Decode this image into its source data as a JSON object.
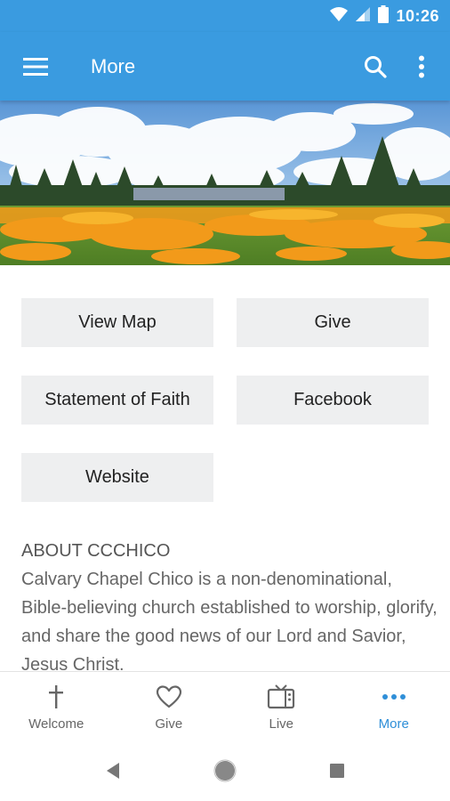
{
  "status": {
    "time": "10:26"
  },
  "app_bar": {
    "title": "More"
  },
  "buttons": [
    {
      "label": "View Map"
    },
    {
      "label": "Give"
    },
    {
      "label": "Statement of Faith"
    },
    {
      "label": "Facebook"
    },
    {
      "label": "Website"
    }
  ],
  "about": {
    "heading": "ABOUT CCCHICO",
    "body": "Calvary Chapel Chico is a non-denominational, Bible-believing church established to worship, glorify, and share the good news of our Lord and Savior, Jesus Christ."
  },
  "bottom_nav": [
    {
      "label": "Welcome",
      "icon": "cross-icon"
    },
    {
      "label": "Give",
      "icon": "heart-icon"
    },
    {
      "label": "Live",
      "icon": "tv-icon"
    },
    {
      "label": "More",
      "icon": "more-dots-icon",
      "active": true
    }
  ],
  "colors": {
    "primary": "#3a9be0",
    "active_nav": "#2f8fd8",
    "button_bg": "#eeeff0"
  }
}
